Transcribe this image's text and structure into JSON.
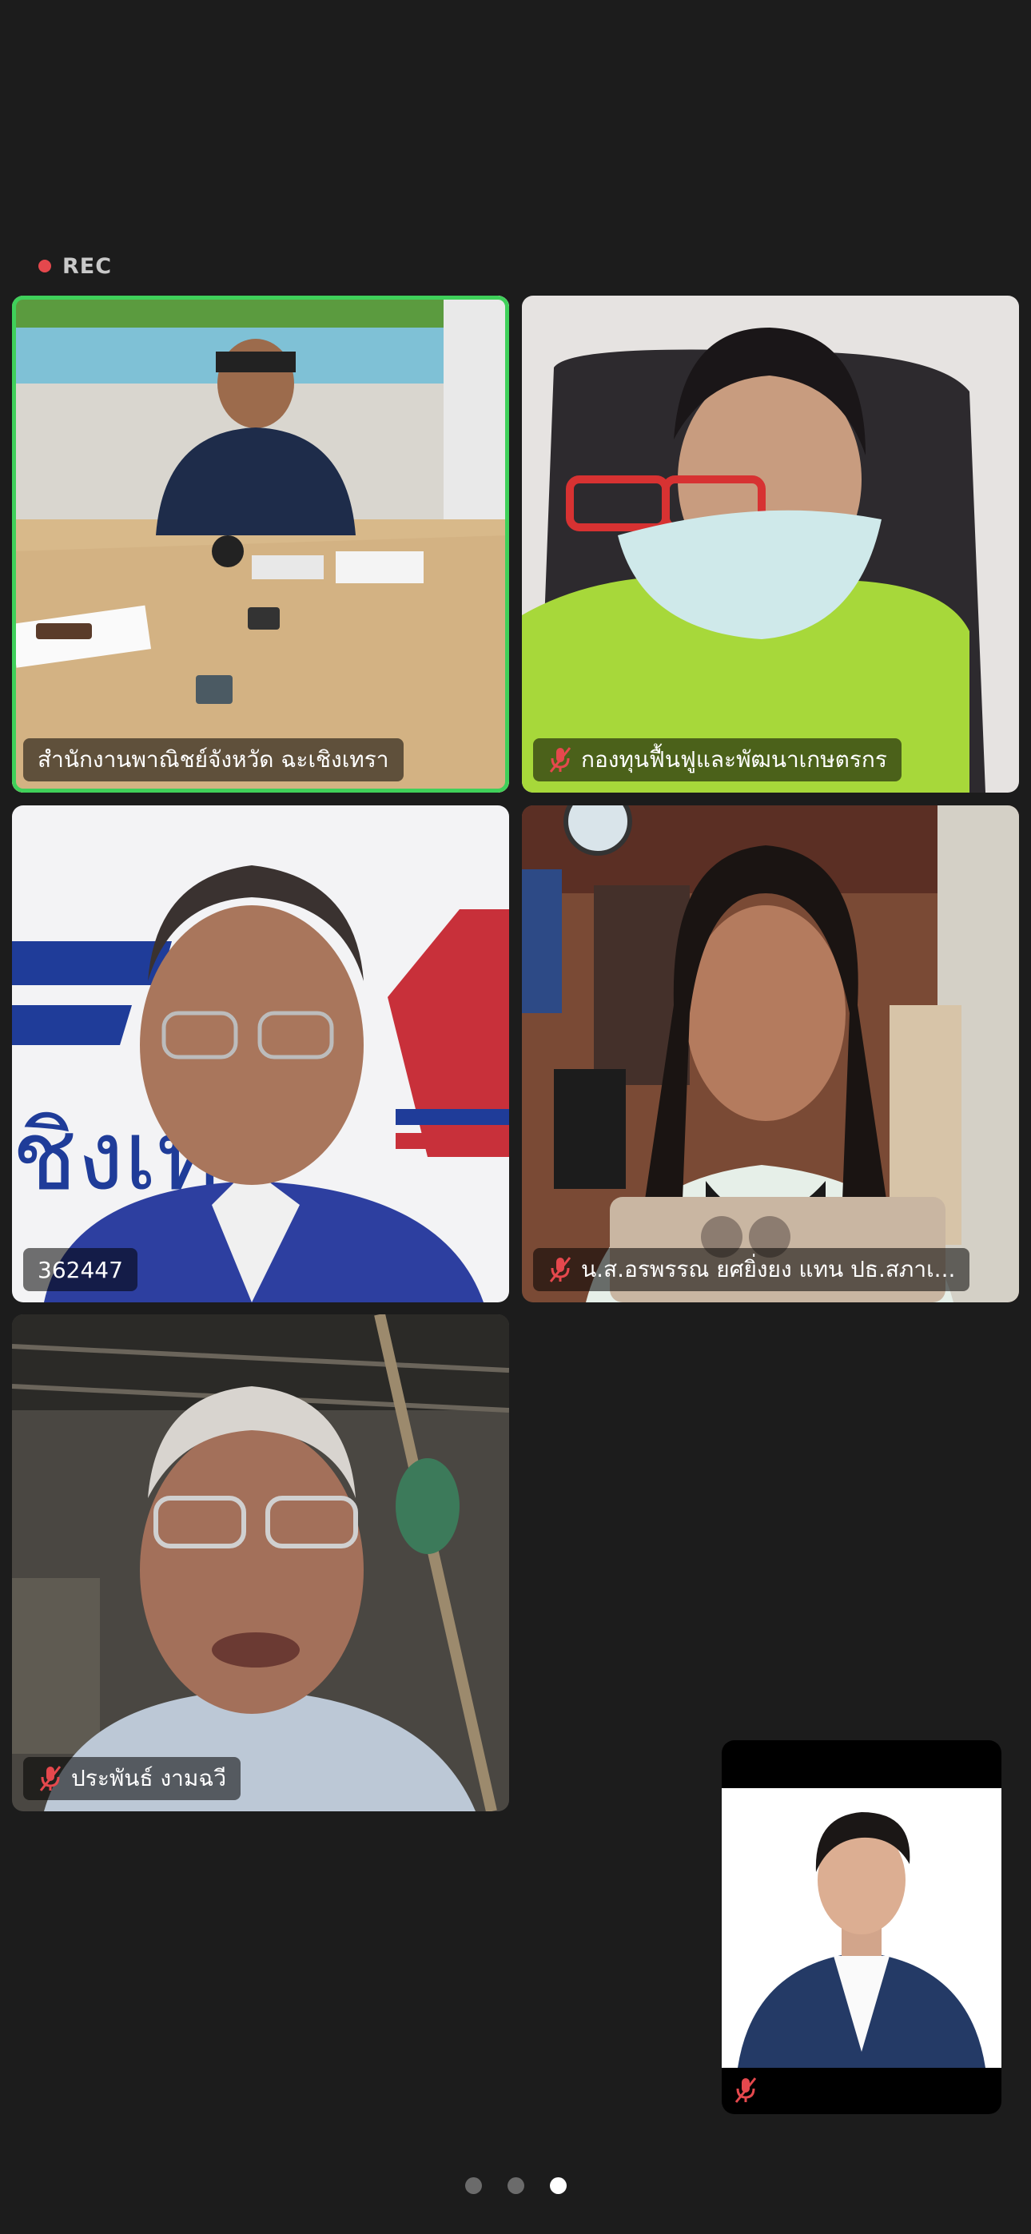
{
  "recording": {
    "label": "REC"
  },
  "participants": [
    {
      "name": "สำนักงานพาณิชย์จังหวัด ฉะเชิงเทรา",
      "muted": false,
      "active_speaker": true
    },
    {
      "name": "กองทุนฟื้นฟูและพัฒนาเกษตรกร",
      "muted": true,
      "active_speaker": false
    },
    {
      "name": "362447",
      "muted": false,
      "active_speaker": false
    },
    {
      "name": "น.ส.อรพรรณ ยศยิ่งยง แทน ปธ.สภาเ...",
      "muted": true,
      "active_speaker": false
    },
    {
      "name": "ประพันธ์ งามฉวี",
      "muted": true,
      "active_speaker": false
    }
  ],
  "self_view": {
    "muted": true
  },
  "pager": {
    "pages": 3,
    "current": 3
  },
  "colors": {
    "background": "#1c1c1c",
    "active_border": "#3fd05a",
    "muted_icon": "#e5484d"
  },
  "icons": [
    "mic-muted-icon",
    "recording-dot-icon"
  ]
}
